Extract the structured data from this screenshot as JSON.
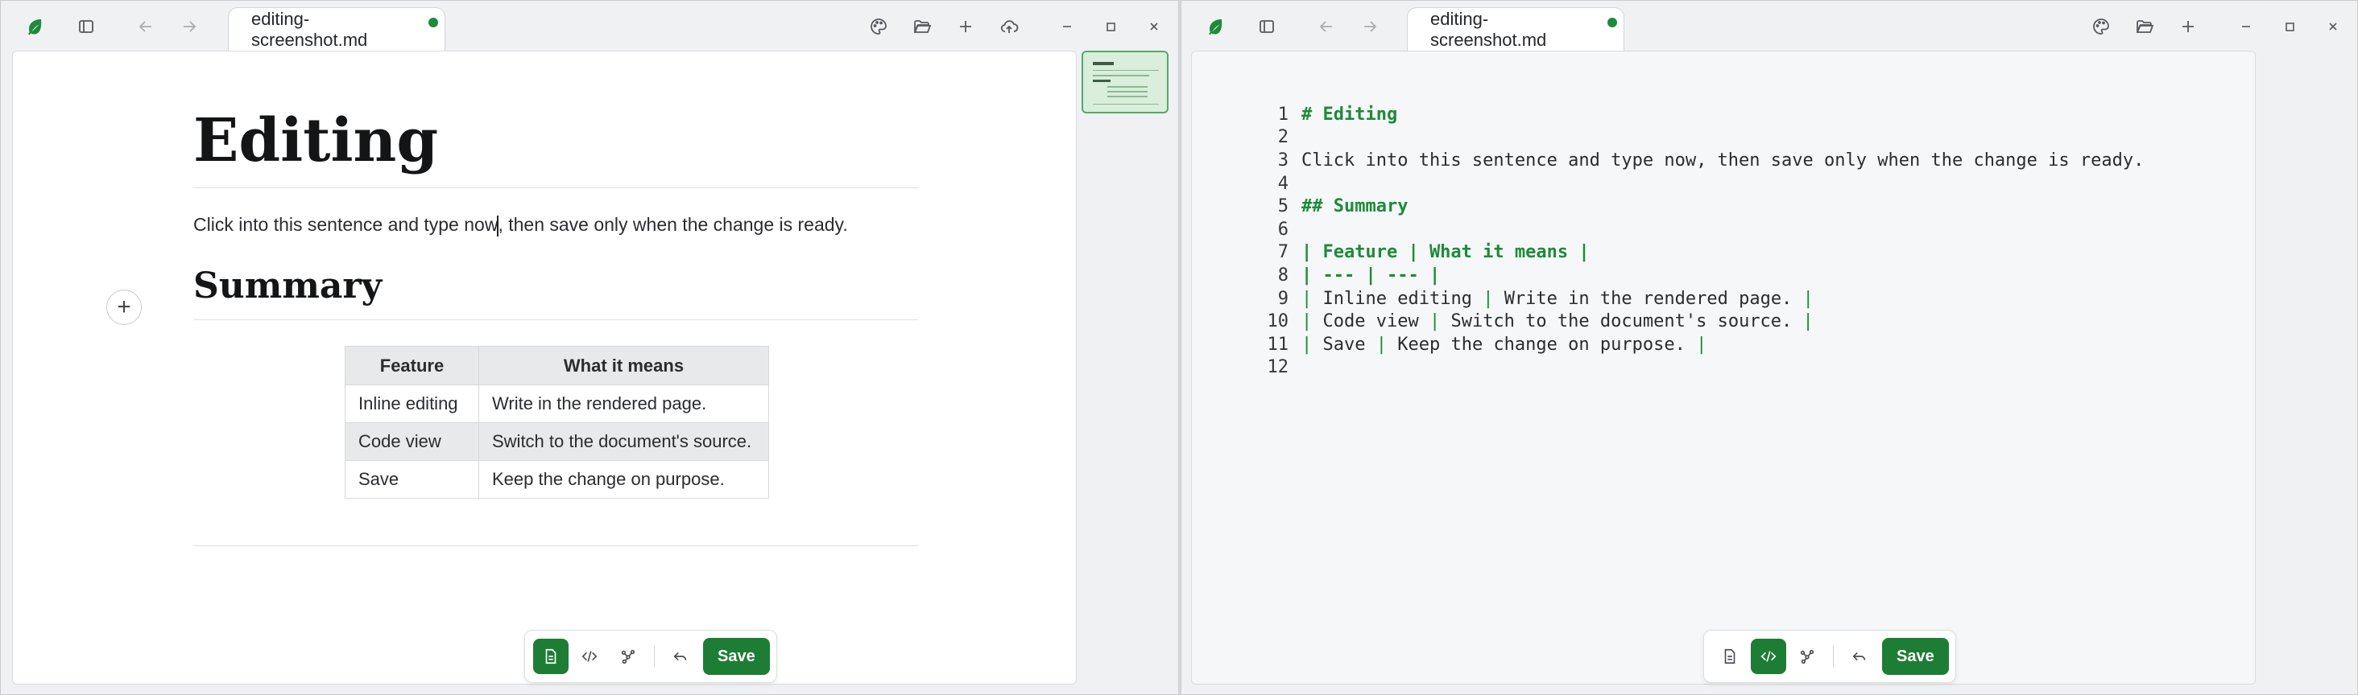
{
  "left": {
    "tab_title": "editing-screenshot.md",
    "doc": {
      "h1": "Editing",
      "para_before": "Click into this sentence and type now",
      "para_after": ", then save only when the change is ready.",
      "h2": "Summary",
      "table": {
        "headers": [
          "Feature",
          "What it means"
        ],
        "rows": [
          [
            "Inline editing",
            "Write in the rendered page."
          ],
          [
            "Code view",
            "Switch to the document's source."
          ],
          [
            "Save",
            "Keep the change on purpose."
          ]
        ]
      }
    },
    "toolbar": {
      "save_label": "Save"
    }
  },
  "right": {
    "tab_title": "editing-screenshot.md",
    "code_lines": [
      {
        "n": "1",
        "parts": [
          {
            "t": "# Editing",
            "c": "g"
          }
        ]
      },
      {
        "n": "2",
        "parts": []
      },
      {
        "n": "3",
        "parts": [
          {
            "t": "Click into this sentence and type now, then save only when the change is ready.",
            "c": "txt"
          }
        ]
      },
      {
        "n": "4",
        "parts": []
      },
      {
        "n": "5",
        "parts": [
          {
            "t": "## Summary",
            "c": "g"
          }
        ]
      },
      {
        "n": "6",
        "parts": []
      },
      {
        "n": "7",
        "parts": [
          {
            "t": "| Feature | What it means |",
            "c": "g"
          }
        ]
      },
      {
        "n": "8",
        "parts": [
          {
            "t": "| --- | --- |",
            "c": "g"
          }
        ]
      },
      {
        "n": "9",
        "parts": [
          {
            "t": "| ",
            "c": "gp"
          },
          {
            "t": "Inline editing ",
            "c": "txt"
          },
          {
            "t": "| ",
            "c": "gp"
          },
          {
            "t": "Write in the rendered page. ",
            "c": "txt"
          },
          {
            "t": "|",
            "c": "gp"
          }
        ]
      },
      {
        "n": "10",
        "parts": [
          {
            "t": "| ",
            "c": "gp"
          },
          {
            "t": "Code view ",
            "c": "txt"
          },
          {
            "t": "| ",
            "c": "gp"
          },
          {
            "t": "Switch to the document's source. ",
            "c": "txt"
          },
          {
            "t": "|",
            "c": "gp"
          }
        ]
      },
      {
        "n": "11",
        "parts": [
          {
            "t": "| ",
            "c": "gp"
          },
          {
            "t": "Save ",
            "c": "txt"
          },
          {
            "t": "| ",
            "c": "gp"
          },
          {
            "t": "Keep the change on purpose. ",
            "c": "txt"
          },
          {
            "t": "|",
            "c": "gp"
          }
        ]
      },
      {
        "n": "12",
        "parts": []
      }
    ],
    "toolbar": {
      "save_label": "Save"
    }
  },
  "colors": {
    "accent": "#1e7d35",
    "heading_code": "#1e8a3a",
    "unsaved_dot": "#1e8a3a"
  }
}
